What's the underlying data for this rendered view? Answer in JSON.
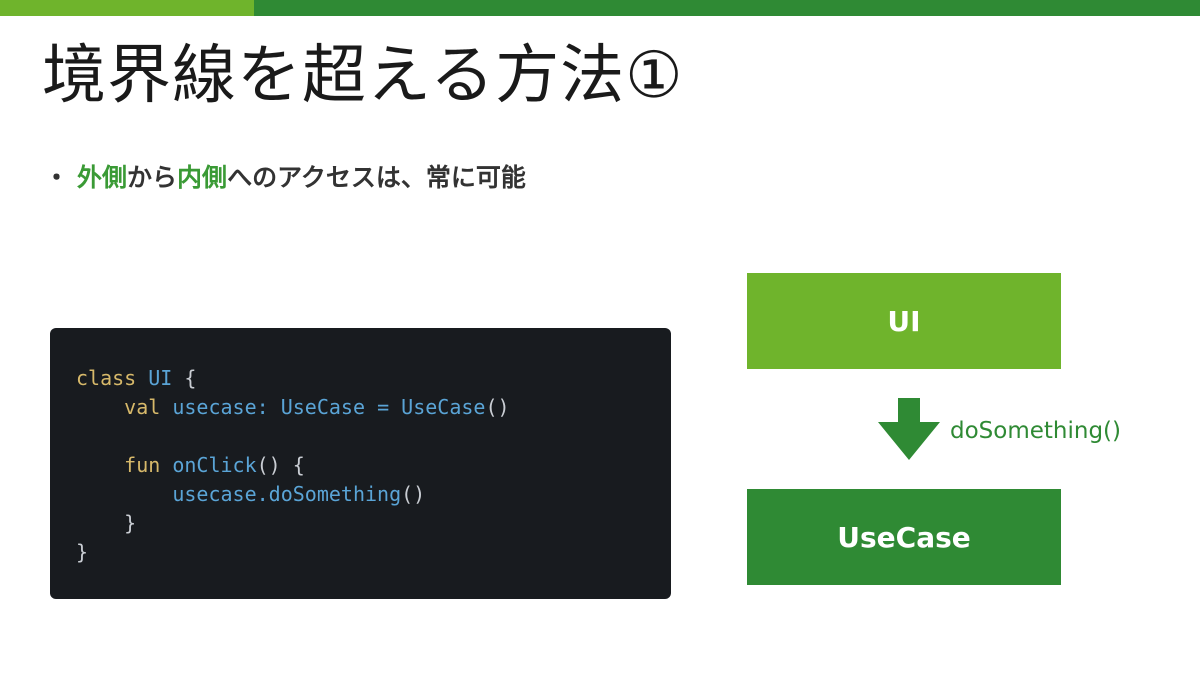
{
  "slide": {
    "title": "境界線を超える方法①",
    "bullet": {
      "dot": "・",
      "highlight1": "外側",
      "text1": "から",
      "highlight2": "内側",
      "text2": "へのアクセスは、常に可能"
    }
  },
  "code": {
    "l1": {
      "k": "class",
      "t": "UI",
      "p": "{"
    },
    "l2": {
      "k": "val",
      "n": "usecase:",
      "t1": "UseCase",
      "op": "=",
      "t2": "UseCase",
      "p": "()"
    },
    "l4": {
      "k": "fun",
      "n": "onClick",
      "p": "() {"
    },
    "l5": {
      "t": "usecase.doSomething",
      "p": "()"
    },
    "l6": {
      "p": "}"
    },
    "l7": {
      "p": "}"
    }
  },
  "diagram": {
    "top_label": "UI",
    "bottom_label": "UseCase",
    "arrow_label": "doSomething()"
  },
  "colors": {
    "light_green": "#6fb42c",
    "dark_green": "#2f8a34",
    "code_bg": "#181b1f"
  }
}
